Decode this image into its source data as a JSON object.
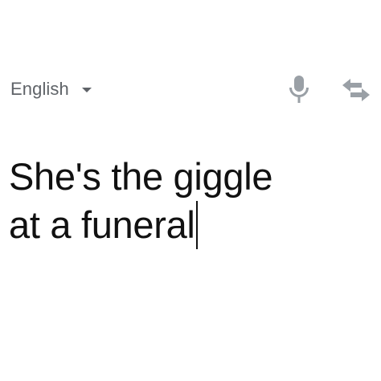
{
  "source_language": {
    "label": "English",
    "icon": "chevron-down-icon"
  },
  "toolbar": {
    "mic_icon": "microphone-icon",
    "swap_icon": "swap-arrows-icon",
    "icon_color": "#9aa0a6"
  },
  "input": {
    "lines": [
      "She's the giggle",
      "at a funeral"
    ]
  }
}
